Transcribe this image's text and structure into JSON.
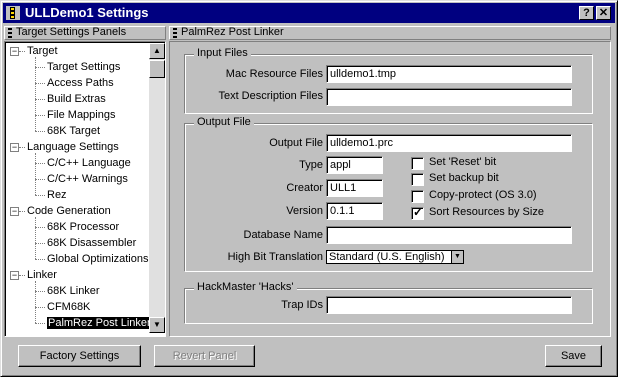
{
  "window": {
    "title": "ULLDemo1 Settings",
    "help_label": "?",
    "close_label": "✕"
  },
  "left_panel": {
    "header": "Target Settings Panels",
    "tree": [
      {
        "label": "Target",
        "children": [
          "Target Settings",
          "Access Paths",
          "Build Extras",
          "File Mappings",
          "68K Target"
        ]
      },
      {
        "label": "Language Settings",
        "children": [
          "C/C++ Language",
          "C/C++ Warnings",
          "Rez"
        ]
      },
      {
        "label": "Code Generation",
        "children": [
          "68K Processor",
          "68K Disassembler",
          "Global Optimizations"
        ]
      },
      {
        "label": "Linker",
        "children": [
          "68K Linker",
          "CFM68K",
          "PalmRez Post Linker"
        ]
      }
    ],
    "selected": "PalmRez Post Linker",
    "scroll_up": "▲",
    "scroll_down": "▼"
  },
  "right_panel": {
    "header": "PalmRez Post Linker",
    "input_files": {
      "title": "Input Files",
      "mac_resource_files_label": "Mac Resource Files",
      "mac_resource_files_value": "ulldemo1.tmp",
      "text_description_files_label": "Text Description Files",
      "text_description_files_value": ""
    },
    "output_file": {
      "title": "Output File",
      "output_file_label": "Output File",
      "output_file_value": "ulldemo1.prc",
      "type_label": "Type",
      "type_value": "appl",
      "creator_label": "Creator",
      "creator_value": "ULL1",
      "version_label": "Version",
      "version_value": "0.1.1",
      "database_name_label": "Database Name",
      "database_name_value": "",
      "high_bit_label": "High Bit Translation",
      "high_bit_value": "Standard (U.S. English)",
      "checkboxes": [
        {
          "label": "Set 'Reset' bit",
          "checked": false
        },
        {
          "label": "Set backup bit",
          "checked": false
        },
        {
          "label": "Copy-protect (OS 3.0)",
          "checked": false
        },
        {
          "label": "Sort Resources by Size",
          "checked": true
        }
      ]
    },
    "hackmaster": {
      "title": "HackMaster 'Hacks'",
      "trap_ids_label": "Trap IDs",
      "trap_ids_value": ""
    }
  },
  "buttons": {
    "factory_settings": "Factory Settings",
    "revert_panel": "Revert Panel",
    "save": "Save"
  }
}
